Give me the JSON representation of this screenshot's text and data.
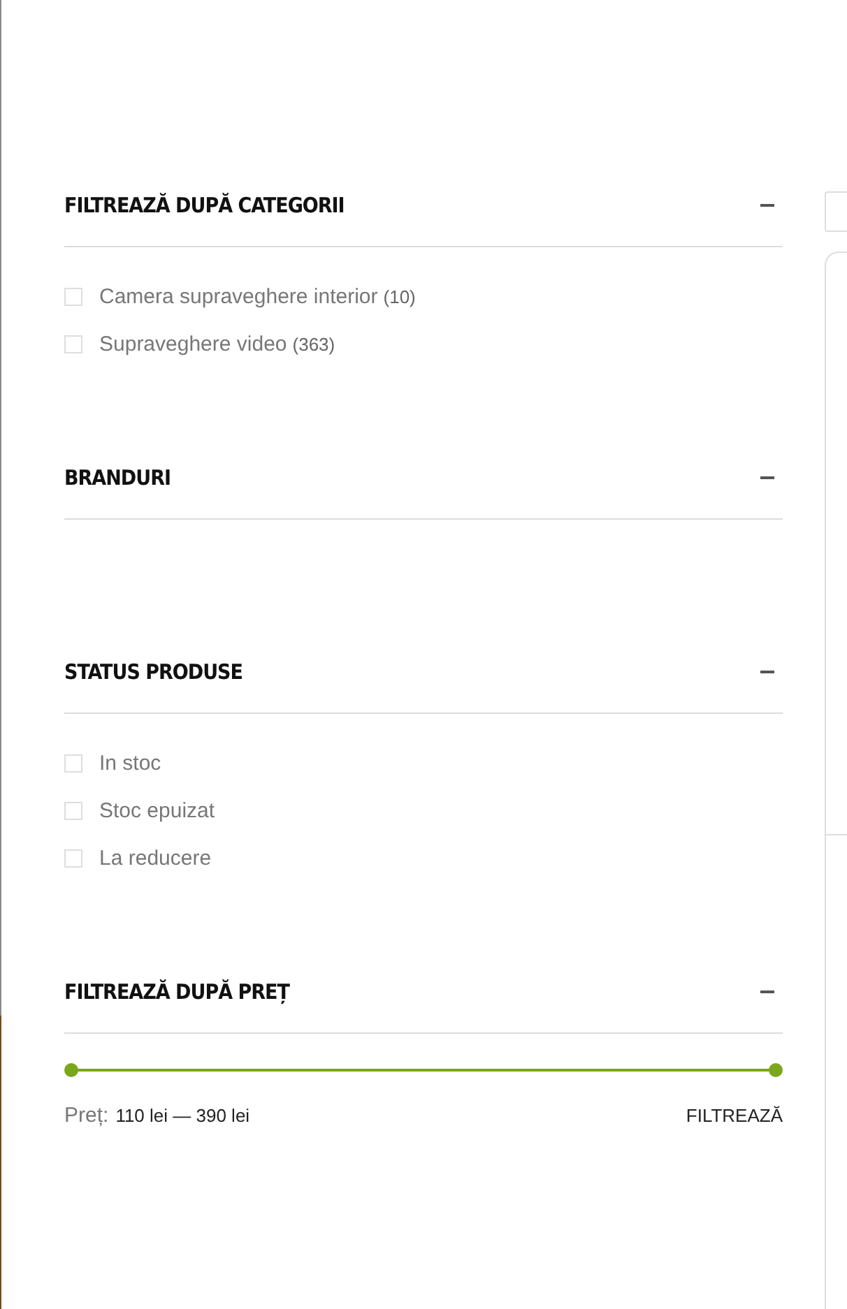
{
  "sections": [
    {
      "kind": "checklist",
      "title": "FILTREAZĂ DUPĂ CATEGORII",
      "expanded": true,
      "items": [
        {
          "label": "Camera supraveghere interior",
          "count": "(10)",
          "checked": false
        },
        {
          "label": "Supraveghere video",
          "count": "(363)",
          "checked": false
        }
      ]
    },
    {
      "kind": "checklist",
      "title": "BRANDURI",
      "expanded": true
    },
    {
      "kind": "checklist",
      "title": "STATUS PRODUSE",
      "expanded": true,
      "items": [
        {
          "label": "In stoc",
          "checked": false
        },
        {
          "label": "Stoc epuizat",
          "checked": false
        },
        {
          "label": "La reducere",
          "checked": false
        }
      ]
    },
    {
      "kind": "price",
      "title": "FILTREAZĂ DUPĂ PREȚ",
      "expanded": true,
      "slider": {
        "level": 1
      },
      "price_label": "Preț:",
      "price_value": "110 lei — 390 lei",
      "button": "FILTREAZĂ"
    }
  ]
}
